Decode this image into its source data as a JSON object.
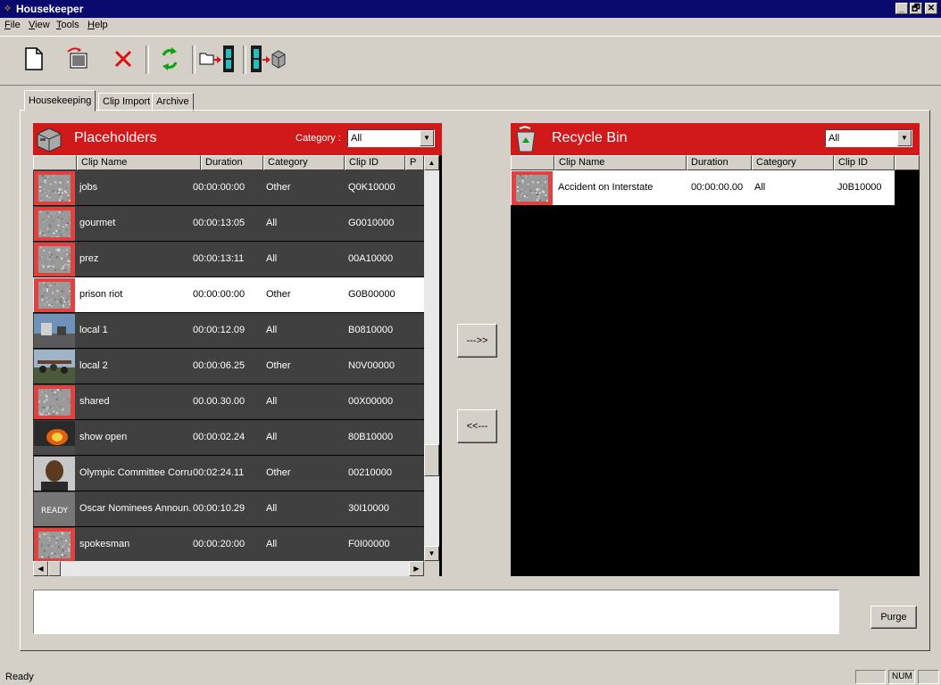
{
  "window": {
    "title": "Housekeeper",
    "minimize": "_",
    "restore": "🗗",
    "close": "✕"
  },
  "menu": [
    {
      "label": "File",
      "accel": "F",
      "rest": "ile"
    },
    {
      "label": "View",
      "accel": "V",
      "rest": "iew"
    },
    {
      "label": "Tools",
      "accel": "T",
      "rest": "ools"
    },
    {
      "label": "Help",
      "accel": "H",
      "rest": "elp"
    }
  ],
  "toolbar": {
    "icons": [
      "new-document-icon",
      "open-clip-icon",
      "delete-icon",
      "refresh-icon",
      "move-to-filmstrip-icon",
      "filmstrip-to-archive-icon"
    ],
    "glyphs": {
      "new": "🗋",
      "delete": "✕",
      "refresh": "⟳"
    }
  },
  "tabs": [
    "Housekeeping",
    "Clip Import",
    "Archive"
  ],
  "placeholders": {
    "title": "Placeholders",
    "category_label": "Category :",
    "category_value": "All",
    "columns": [
      "Clip Name",
      "Duration",
      "Category",
      "Clip ID",
      "P"
    ],
    "rows": [
      {
        "name": "jobs",
        "duration": "00:00:00:00",
        "category": "Other",
        "clip_id": "Q0K10000",
        "thumb": "static",
        "selected": false
      },
      {
        "name": "gourmet",
        "duration": "00:00:13:05",
        "category": "All",
        "clip_id": "G0010000",
        "thumb": "static",
        "selected": false
      },
      {
        "name": "prez",
        "duration": "00:00:13:11",
        "category": "All",
        "clip_id": "00A10000",
        "thumb": "static",
        "selected": false
      },
      {
        "name": "prison riot",
        "duration": "00:00:00:00",
        "category": "Other",
        "clip_id": "G0B00000",
        "thumb": "static",
        "selected": true
      },
      {
        "name": "local 1",
        "duration": "00:00:12.09",
        "category": "All",
        "clip_id": "B0810000",
        "thumb": "street",
        "selected": false
      },
      {
        "name": "local 2",
        "duration": "00:00:06.25",
        "category": "Other",
        "clip_id": "N0V00000",
        "thumb": "crowd",
        "selected": false
      },
      {
        "name": "shared",
        "duration": "00.00.30.00",
        "category": "All",
        "clip_id": "00X00000",
        "thumb": "static",
        "selected": false
      },
      {
        "name": "show open",
        "duration": "00:00:02.24",
        "category": "All",
        "clip_id": "80B10000",
        "thumb": "fire",
        "selected": false
      },
      {
        "name": "Olympic Committee Corru...",
        "duration": "00:02:24.11",
        "category": "Other",
        "clip_id": "00210000",
        "thumb": "person",
        "selected": false
      },
      {
        "name": "Oscar Nominees Announ...",
        "duration": "00:00:10.29",
        "category": "All",
        "clip_id": "30I10000",
        "thumb": "ready",
        "ready_text": "READY",
        "selected": false
      },
      {
        "name": "spokesman",
        "duration": "00:00:20:00",
        "category": "All",
        "clip_id": "F0I00000",
        "thumb": "static",
        "selected": false
      }
    ]
  },
  "transfer": {
    "to_recycle": "--->>",
    "from_recycle": "<<---"
  },
  "recycle_bin": {
    "title": "Recycle Bin",
    "filter_value": "All",
    "columns": [
      "Clip Name",
      "Duration",
      "Category",
      "Clip ID"
    ],
    "rows": [
      {
        "name": "Accident on Interstate",
        "duration": "00:00:00.00",
        "category": "All",
        "clip_id": "J0B10000",
        "thumb": "static"
      }
    ]
  },
  "purge_label": "Purge",
  "status": {
    "text": "Ready",
    "num": "NUM"
  }
}
